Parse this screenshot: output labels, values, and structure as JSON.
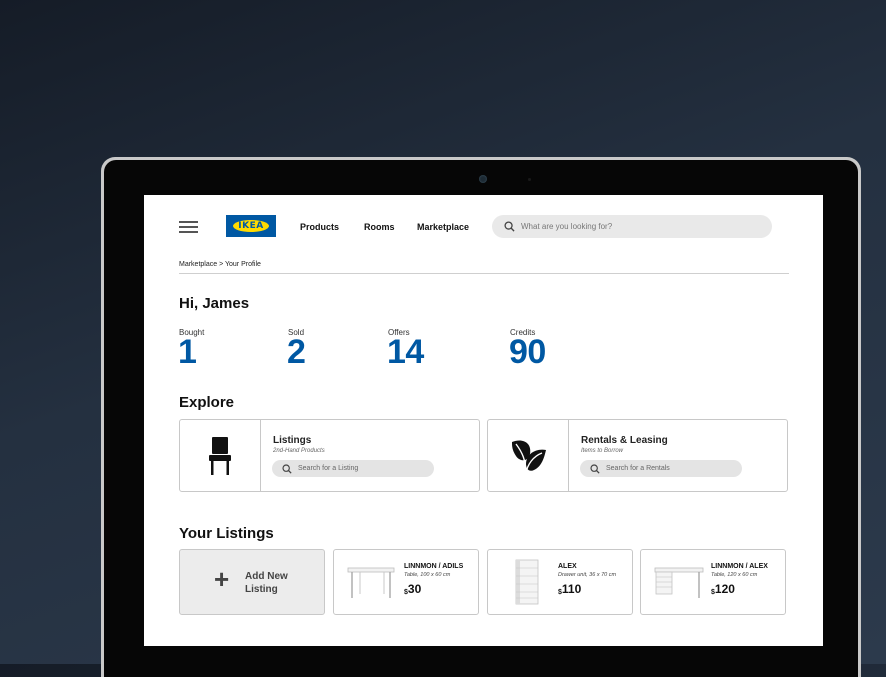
{
  "header": {
    "logo_text": "IKEA",
    "nav": [
      "Products",
      "Rooms",
      "Marketplace"
    ],
    "search_placeholder": "What are you looking for?"
  },
  "breadcrumb": "Marketplace > Your Profile",
  "greeting": "Hi, James",
  "stats": [
    {
      "label": "Bought",
      "value": "1"
    },
    {
      "label": "Sold",
      "value": "2"
    },
    {
      "label": "Offers",
      "value": "14"
    },
    {
      "label": "Credits",
      "value": "90"
    }
  ],
  "explore": {
    "title": "Explore",
    "cards": [
      {
        "title": "Listings",
        "subtitle": "2nd-Hand Products",
        "search_placeholder": "Search for a Listing",
        "icon": "chair-icon"
      },
      {
        "title": "Rentals & Leasing",
        "subtitle": "Items to Borrow",
        "search_placeholder": "Search for a Rentals",
        "icon": "leaf-icon"
      }
    ]
  },
  "listings": {
    "title": "Your Listings",
    "add_label": "Add New Listing",
    "items": [
      {
        "name": "LINNMON / ADILS",
        "desc": "Table, 100 x 60 cm",
        "currency": "$",
        "price": "30",
        "icon": "table-image"
      },
      {
        "name": "ALEX",
        "desc": "Drawer unit, 36 x 70 cm",
        "currency": "$",
        "price": "110",
        "icon": "drawer-image"
      },
      {
        "name": "LINNMON / ALEX",
        "desc": "Table, 120 x 60 cm",
        "currency": "$",
        "price": "120",
        "icon": "desk-image"
      }
    ]
  },
  "colors": {
    "brand_blue": "#0058a3",
    "brand_yellow": "#ffdb00"
  }
}
